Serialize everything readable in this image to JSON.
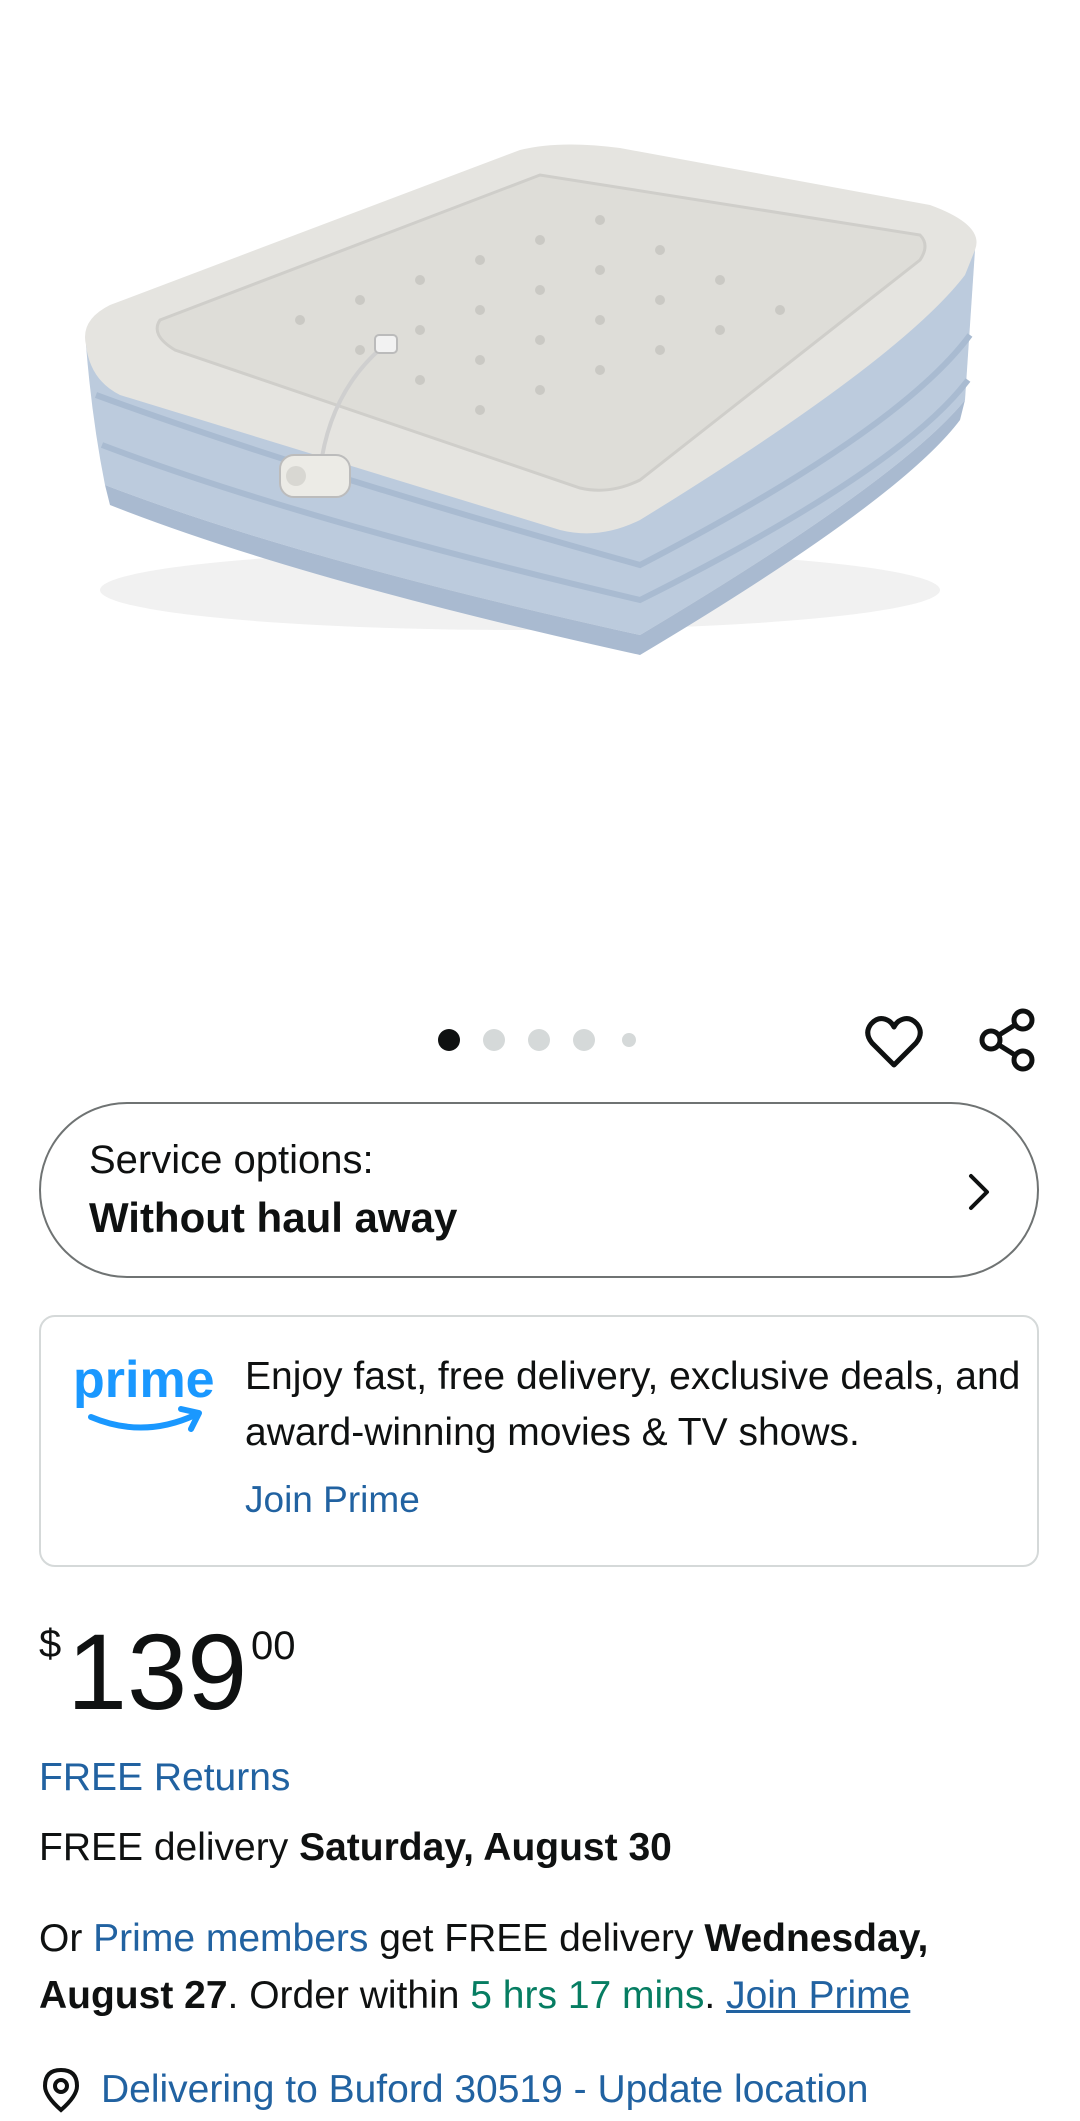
{
  "gallery": {
    "image_alt": "Queen air mattress with built-in pump",
    "dot_count": 5,
    "active_index": 0
  },
  "actions": {
    "wishlist_icon": "heart-icon",
    "share_icon": "share-icon"
  },
  "service_options": {
    "label": "Service options:",
    "value": "Without haul away",
    "chevron_icon": "chevron-right-icon"
  },
  "prime_promo": {
    "logo_text": "prime",
    "message": "Enjoy fast, free delivery, exclusive deals, and award-winning movies & TV shows.",
    "join_label": "Join Prime"
  },
  "price": {
    "symbol": "$",
    "whole": "139",
    "fraction": "00"
  },
  "returns": {
    "label": "FREE Returns"
  },
  "delivery": {
    "prefix": "FREE delivery ",
    "date": "Saturday, August 30"
  },
  "prime_delivery": {
    "or": "Or ",
    "members_link": "Prime members",
    "get_free": " get FREE delivery ",
    "date": "Wednesday, August 27",
    "order_within": ". Order within ",
    "countdown": "5 hrs 17 mins",
    "dot": ". ",
    "join_link": "Join Prime"
  },
  "location": {
    "icon": "location-pin-icon",
    "text": "Delivering to Buford 30519 - Update location"
  },
  "colors": {
    "link": "#2162a1",
    "countdown": "#067d62",
    "prime_blue": "#1a98ff",
    "mattress_top": "#e4e3df",
    "mattress_side": "#b9c9dc"
  }
}
